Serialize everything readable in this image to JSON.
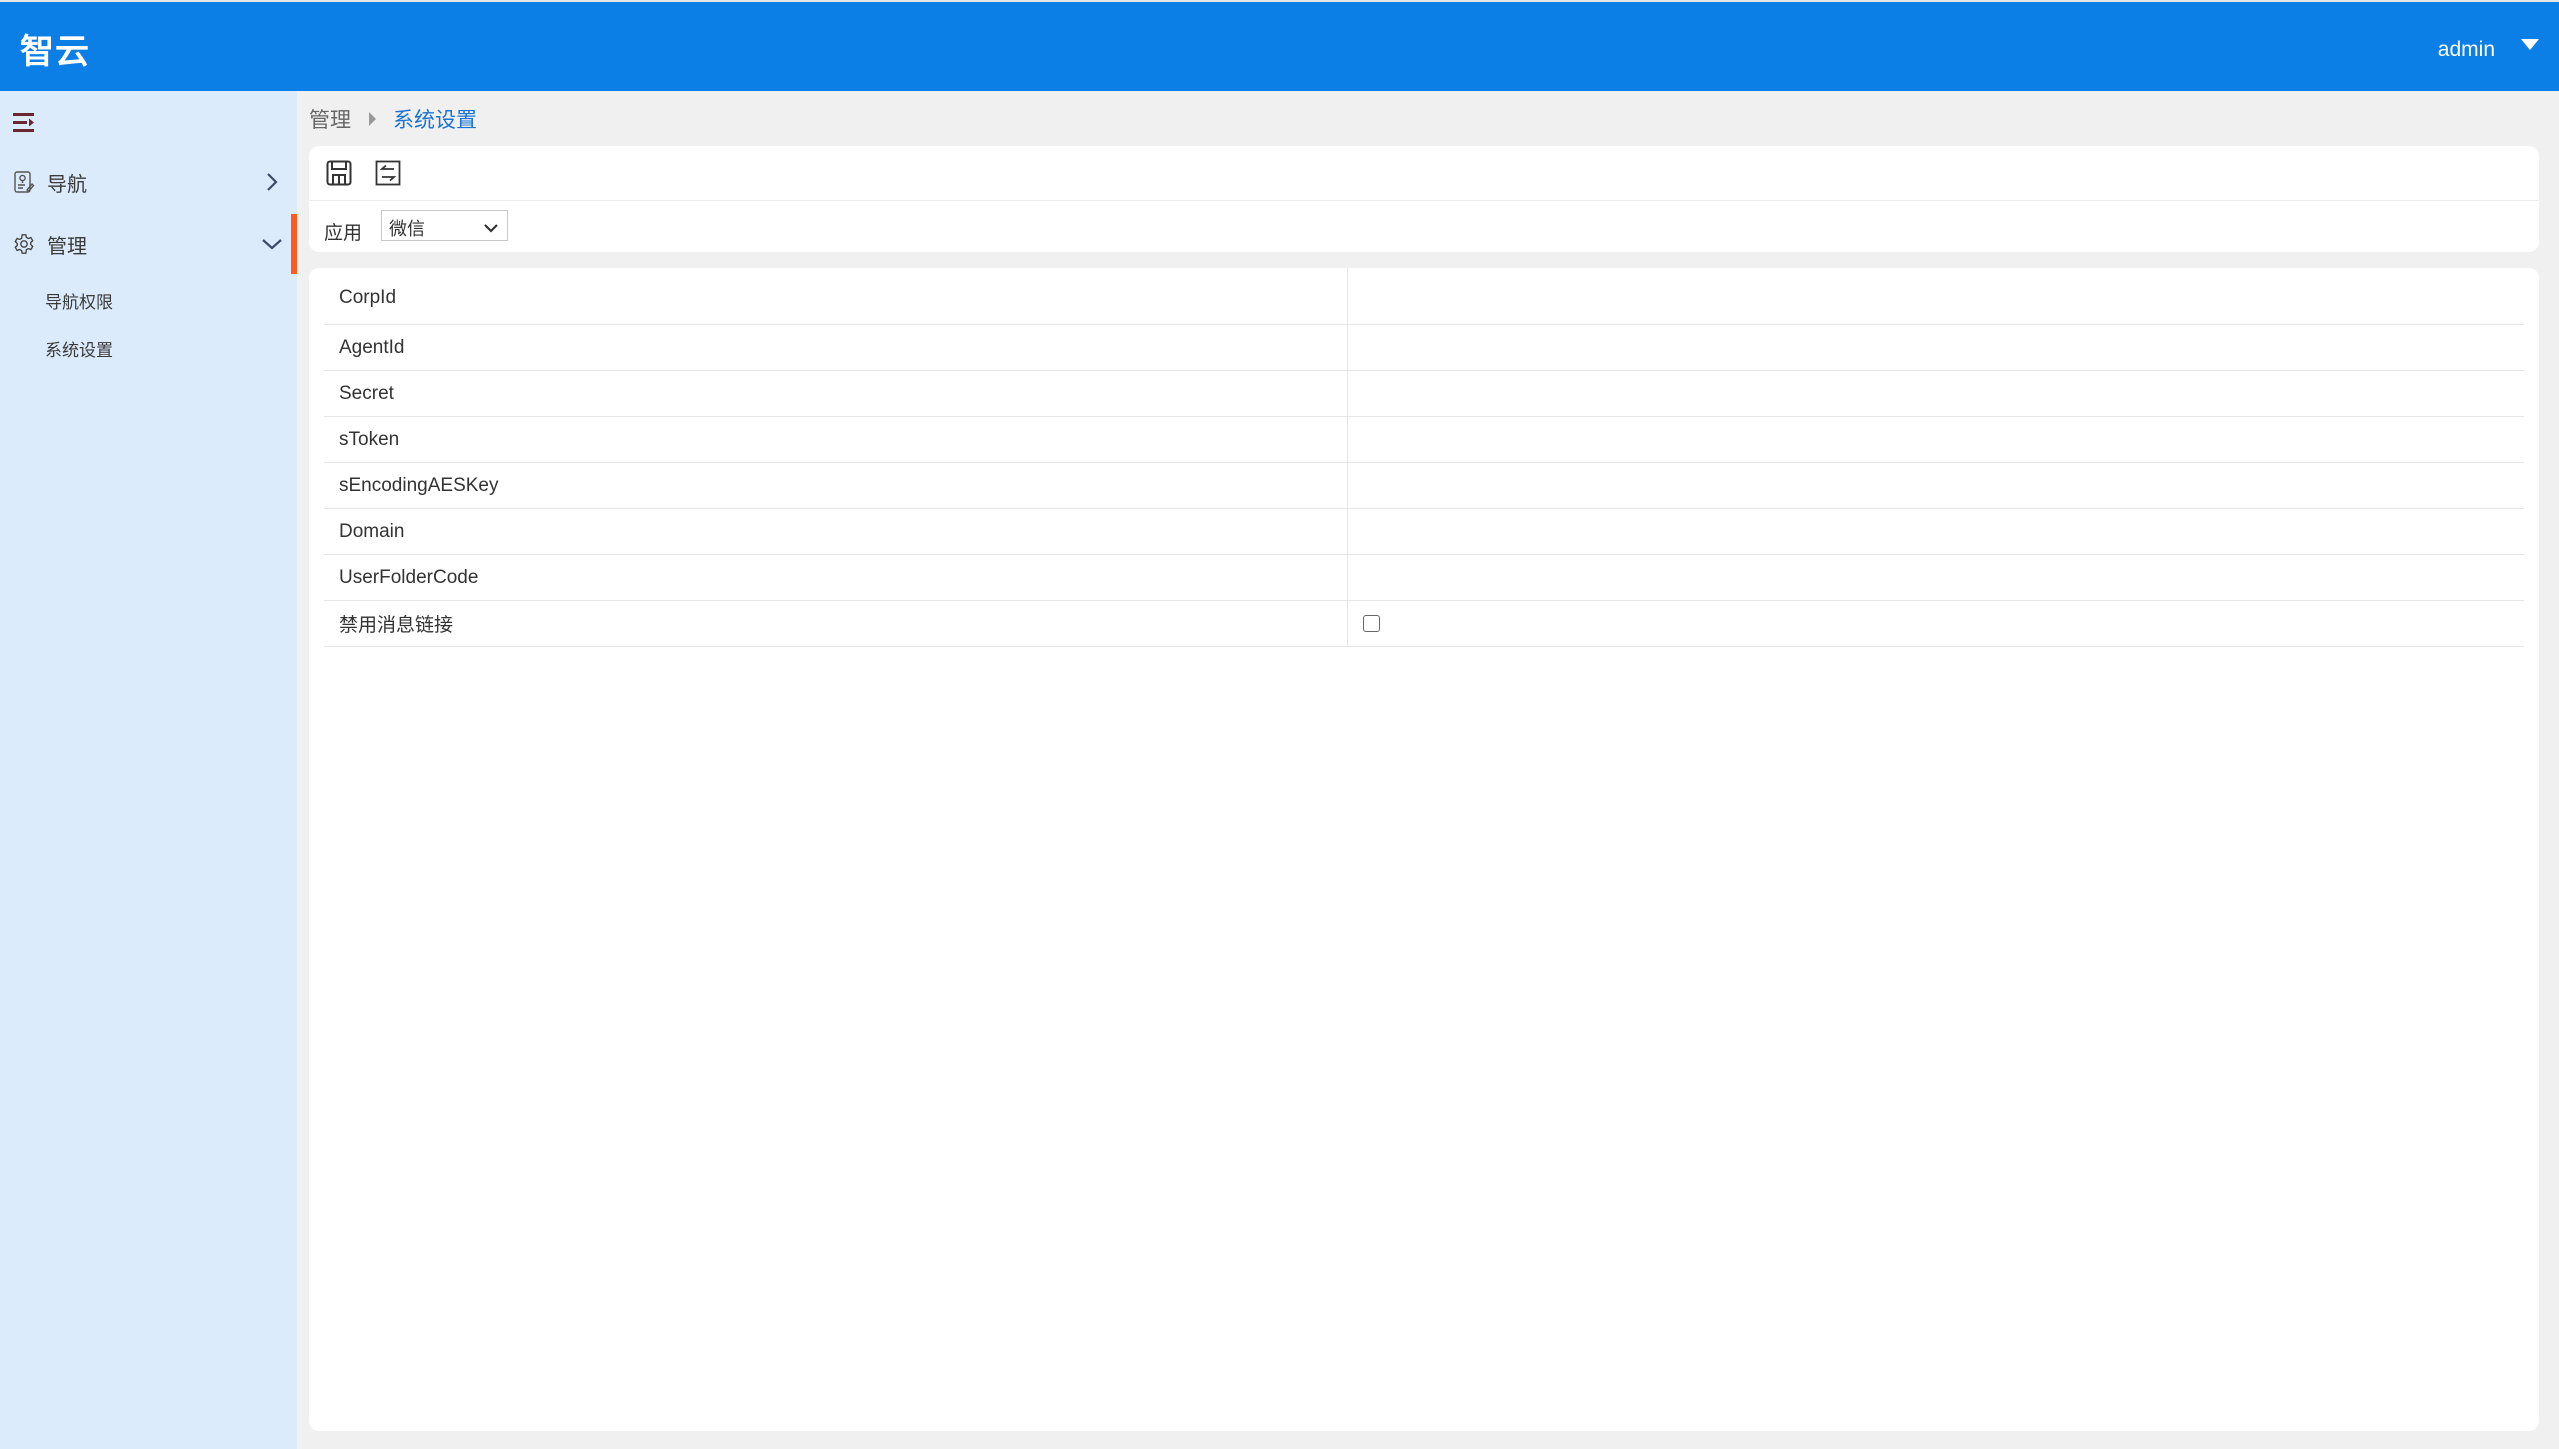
{
  "header": {
    "brand": "智云",
    "user": "admin",
    "bg_color": "#0c7fe6"
  },
  "sidebar": {
    "collapse_icon": "menu-collapse-icon",
    "items": [
      {
        "label": "导航",
        "icon": "map-document-icon",
        "expanded": false
      },
      {
        "label": "管理",
        "icon": "gear-icon",
        "expanded": true,
        "active": true,
        "children": [
          {
            "label": "导航权限"
          },
          {
            "label": "系统设置"
          }
        ]
      }
    ],
    "active_color": "#ff5a1f"
  },
  "breadcrumb": {
    "parent": "管理",
    "current": "系统设置"
  },
  "toolbar": {
    "buttons": [
      {
        "name": "save",
        "icon": "save-icon"
      },
      {
        "name": "switch",
        "icon": "switch-icon"
      }
    ],
    "filter": {
      "label": "应用",
      "selected": "微信"
    }
  },
  "form": {
    "rows": [
      {
        "label": "CorpId",
        "value": ""
      },
      {
        "label": "AgentId",
        "value": ""
      },
      {
        "label": "Secret",
        "value": ""
      },
      {
        "label": "sToken",
        "value": ""
      },
      {
        "label": "sEncodingAESKey",
        "value": ""
      },
      {
        "label": "Domain",
        "value": ""
      },
      {
        "label": "UserFolderCode",
        "value": ""
      },
      {
        "label": "禁用消息链接",
        "type": "checkbox",
        "checked": false
      }
    ]
  }
}
